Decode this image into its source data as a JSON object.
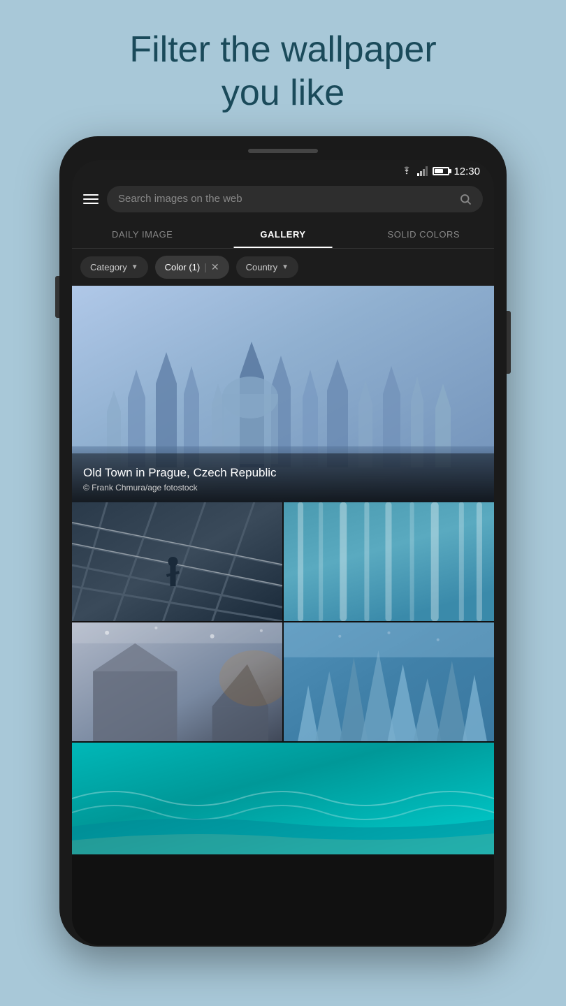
{
  "headline": {
    "line1": "Filter the wallpaper",
    "line2": "you like"
  },
  "statusBar": {
    "time": "12:30"
  },
  "searchBar": {
    "placeholder": "Search images on the web"
  },
  "tabs": [
    {
      "label": "DAILY IMAGE",
      "active": false
    },
    {
      "label": "GALLERY",
      "active": true
    },
    {
      "label": "SOLID COLORS",
      "active": false
    }
  ],
  "filters": [
    {
      "label": "Category",
      "hasChevron": true,
      "active": false
    },
    {
      "label": "Color (1)",
      "hasClose": true,
      "active": true
    },
    {
      "label": "Country",
      "hasChevron": true,
      "active": false
    }
  ],
  "mainImage": {
    "title": "Old Town in Prague, Czech Republic",
    "credit": "©  Frank Chmura/age fotostock"
  }
}
